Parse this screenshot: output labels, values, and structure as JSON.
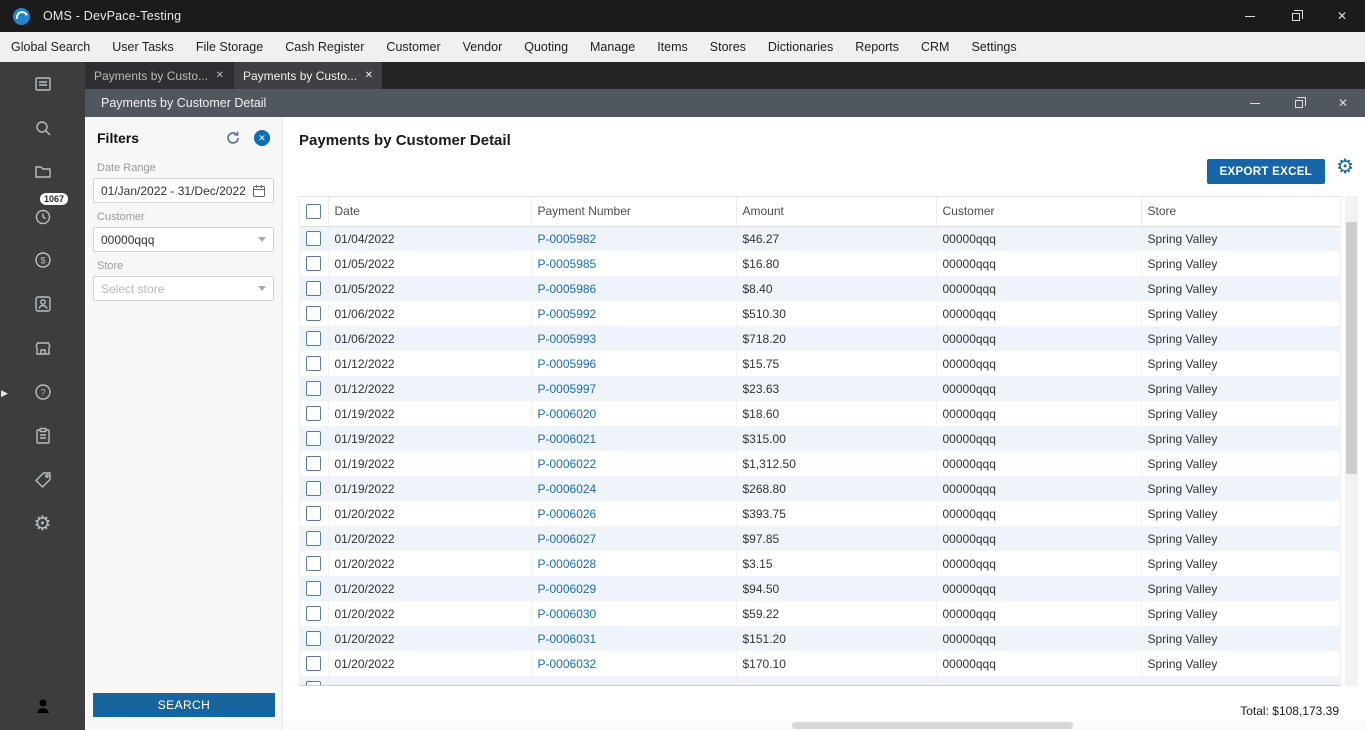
{
  "colors": {
    "accent_blue": "#1565a8",
    "link_blue": "#1a6bbf",
    "row_alt_blue": "#eef4fa",
    "titlebar_bg": "#1b1b1c",
    "sidebar_bg": "#3d3d40",
    "inner_titlebar_bg": "#51575f"
  },
  "window": {
    "title": "OMS - DevPace-Testing"
  },
  "menu": {
    "items": [
      "Global Search",
      "User Tasks",
      "File Storage",
      "Cash Register",
      "Customer",
      "Vendor",
      "Quoting",
      "Manage",
      "Items",
      "Stores",
      "Dictionaries",
      "Reports",
      "CRM",
      "Settings"
    ]
  },
  "sidebar": {
    "notification_badge": "1067",
    "icons": [
      "dashboard",
      "search",
      "folder",
      "clock",
      "dollar",
      "contact",
      "store",
      "help",
      "tasks",
      "tag",
      "settings"
    ],
    "bottom_icon": "user"
  },
  "tabs": [
    {
      "label": "Payments by Custo...",
      "active": false
    },
    {
      "label": "Payments by Custo...",
      "active": true
    }
  ],
  "inner_window": {
    "title": "Payments by Customer Detail"
  },
  "filters": {
    "title": "Filters",
    "fields": {
      "date_range": {
        "label": "Date Range",
        "value": "01/Jan/2022 - 31/Dec/2022"
      },
      "customer": {
        "label": "Customer",
        "value": "00000qqq"
      },
      "store": {
        "label": "Store",
        "placeholder": "Select store"
      }
    },
    "search_button": "SEARCH"
  },
  "main": {
    "title": "Payments by Customer Detail",
    "export_button": "EXPORT EXCEL",
    "table": {
      "columns": [
        "Date",
        "Payment Number",
        "Amount",
        "Customer",
        "Store"
      ],
      "rows": [
        [
          "01/04/2022",
          "P-0005982",
          "$46.27",
          "00000qqq",
          "Spring Valley"
        ],
        [
          "01/05/2022",
          "P-0005985",
          "$16.80",
          "00000qqq",
          "Spring Valley"
        ],
        [
          "01/05/2022",
          "P-0005986",
          "$8.40",
          "00000qqq",
          "Spring Valley"
        ],
        [
          "01/06/2022",
          "P-0005992",
          "$510.30",
          "00000qqq",
          "Spring Valley"
        ],
        [
          "01/06/2022",
          "P-0005993",
          "$718.20",
          "00000qqq",
          "Spring Valley"
        ],
        [
          "01/12/2022",
          "P-0005996",
          "$15.75",
          "00000qqq",
          "Spring Valley"
        ],
        [
          "01/12/2022",
          "P-0005997",
          "$23.63",
          "00000qqq",
          "Spring Valley"
        ],
        [
          "01/19/2022",
          "P-0006020",
          "$18.60",
          "00000qqq",
          "Spring Valley"
        ],
        [
          "01/19/2022",
          "P-0006021",
          "$315.00",
          "00000qqq",
          "Spring Valley"
        ],
        [
          "01/19/2022",
          "P-0006022",
          "$1,312.50",
          "00000qqq",
          "Spring Valley"
        ],
        [
          "01/19/2022",
          "P-0006024",
          "$268.80",
          "00000qqq",
          "Spring Valley"
        ],
        [
          "01/20/2022",
          "P-0006026",
          "$393.75",
          "00000qqq",
          "Spring Valley"
        ],
        [
          "01/20/2022",
          "P-0006027",
          "$97.85",
          "00000qqq",
          "Spring Valley"
        ],
        [
          "01/20/2022",
          "P-0006028",
          "$3.15",
          "00000qqq",
          "Spring Valley"
        ],
        [
          "01/20/2022",
          "P-0006029",
          "$94.50",
          "00000qqq",
          "Spring Valley"
        ],
        [
          "01/20/2022",
          "P-0006030",
          "$59.22",
          "00000qqq",
          "Spring Valley"
        ],
        [
          "01/20/2022",
          "P-0006031",
          "$151.20",
          "00000qqq",
          "Spring Valley"
        ],
        [
          "01/20/2022",
          "P-0006032",
          "$170.10",
          "00000qqq",
          "Spring Valley"
        ]
      ],
      "partial_row_visible": true
    },
    "total_label": "Total: $108,173.39"
  }
}
